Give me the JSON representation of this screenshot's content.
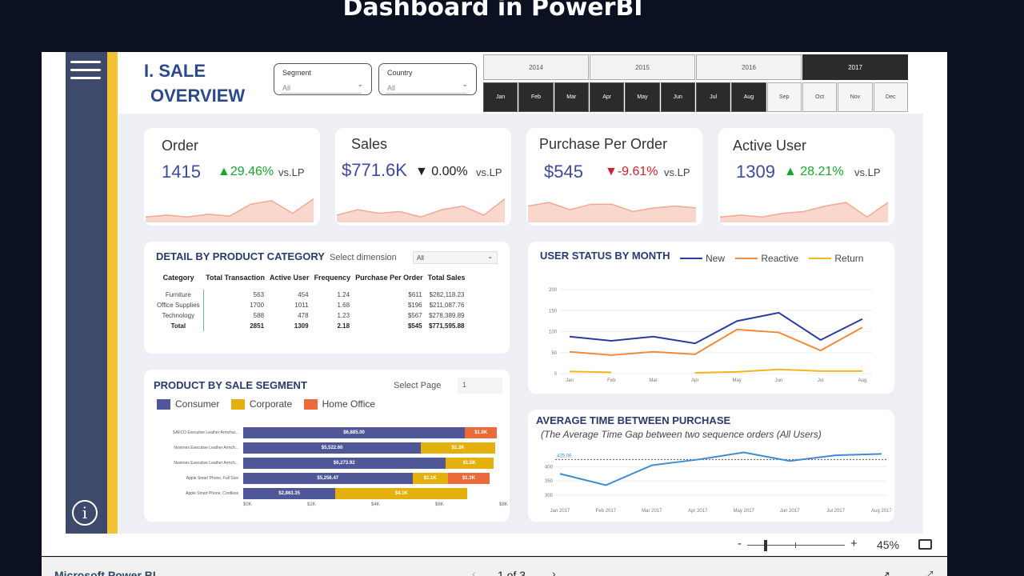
{
  "page_title": "Dashboard in PowerBI",
  "report": {
    "title_line1": "I. SALE",
    "title_line2": "OVERVIEW",
    "segment_slicer": {
      "label": "Segment",
      "value": "All"
    },
    "country_slicer": {
      "label": "Country",
      "value": "All"
    },
    "years": [
      "2014",
      "2015",
      "2016",
      "2017"
    ],
    "selected_year": "2017",
    "months": [
      "Jan",
      "Feb",
      "Mar",
      "Apr",
      "May",
      "Jun",
      "Jul",
      "Aug",
      "Sep",
      "Oct",
      "Nov",
      "Dec"
    ]
  },
  "kpis": [
    {
      "title": "Order",
      "value": "1415",
      "delta": "▲29.46%",
      "vs": "vs.LP",
      "direction": "up"
    },
    {
      "title": "Sales",
      "value": "$771.6K",
      "delta": "▼ 0.00%",
      "vs": "vs.LP",
      "direction": "down"
    },
    {
      "title": "Purchase Per Order",
      "value": "$545",
      "delta": "▼-9.61%",
      "vs": "vs.LP",
      "direction": "down"
    },
    {
      "title": "Active User",
      "value": "1309",
      "delta": "▲ 28.21%",
      "vs": "vs.LP",
      "direction": "up"
    }
  ],
  "category_table": {
    "title": "DETAIL BY PRODUCT CATEGORY",
    "select_label": "Select dimension",
    "select_value": "All",
    "headers": [
      "Category",
      "Total Transaction",
      "Active User",
      "Frequency",
      "Purchase Per Order",
      "Total Sales"
    ],
    "rows": [
      [
        "Furniture",
        "563",
        "454",
        "1.24",
        "$611",
        "$282,118.23"
      ],
      [
        "Office Supplies",
        "1700",
        "1011",
        "1.68",
        "$196",
        "$211,087.76"
      ],
      [
        "Technology",
        "588",
        "478",
        "1.23",
        "$567",
        "$278,389.89"
      ]
    ],
    "total": [
      "Total",
      "2851",
      "1309",
      "2.18",
      "$545",
      "$771,595.88"
    ]
  },
  "segment_chart": {
    "title": "PRODUCT BY SALE SEGMENT",
    "select_page_label": "Select Page",
    "select_page_value": "1",
    "legend": [
      "Consumer",
      "Corporate",
      "Home Office"
    ],
    "x_ticks": [
      "$0K",
      "$2K",
      "$4K",
      "$6K",
      "$8K"
    ]
  },
  "user_status": {
    "title": "USER STATUS BY MONTH",
    "legend": [
      "New",
      "Reactive",
      "Return"
    ]
  },
  "avg_time": {
    "title": "AVERAGE TIME BETWEEN PURCHASE",
    "subtitle": "(The Average Time Gap between two sequence orders (All Users)",
    "ref_label": "425.06"
  },
  "zoom": {
    "minus": "-",
    "plus": "+",
    "level": "45%"
  },
  "footer": {
    "app": "Microsoft Power BI",
    "pages": "1 of 3"
  },
  "colors": {
    "consumer": "#4f5796",
    "corporate": "#e3b00d",
    "home_office": "#ea6a3a",
    "new": "#2b3a9e",
    "reactive": "#f08a3c",
    "return": "#f2b71c",
    "avg": "#3f8ad0",
    "up": "#1aa32d",
    "down": "#d0222d"
  },
  "chart_data": [
    {
      "type": "bar",
      "title": "PRODUCT BY SALE SEGMENT",
      "orientation": "horizontal-stacked",
      "categories": [
        "SAFCO Executive Leather Armchai...",
        "Novimex Executive Leather Armch...",
        "Novimex Executive Leather Armch...",
        "Apple Smart Phone, Full Size",
        "Apple Smart Phone, Cordless"
      ],
      "series": [
        {
          "name": "Consumer",
          "values": [
            6885.0,
            5522.6,
            6273.92,
            5256.47,
            2863.35
          ],
          "labels": [
            "$6,885.00",
            "$5,522.60",
            "$6,273.92",
            "$5,256.47",
            "$2,863.35"
          ]
        },
        {
          "name": "Corporate",
          "values": [
            0,
            2300,
            1500,
            1100,
            4100
          ],
          "labels": [
            "",
            "$2.3K",
            "$1.5K",
            "$1.1K",
            "$4.1K"
          ]
        },
        {
          "name": "Home Office",
          "values": [
            1000,
            0,
            0,
            1300,
            0
          ],
          "labels": [
            "$1.0K",
            "",
            "",
            "$1.3K",
            ""
          ]
        }
      ],
      "xlim": [
        0,
        8000
      ]
    },
    {
      "type": "line",
      "title": "USER STATUS BY MONTH",
      "categories": [
        "Jan",
        "Feb",
        "Mar",
        "Apr",
        "May",
        "Jun",
        "Jul",
        "Aug"
      ],
      "y_ticks": [
        "0",
        "50",
        "100",
        "150",
        "200"
      ],
      "ylim": [
        0,
        200
      ],
      "series": [
        {
          "name": "New",
          "values": [
            88,
            78,
            88,
            72,
            125,
            145,
            80,
            130
          ]
        },
        {
          "name": "Reactive",
          "values": [
            52,
            44,
            52,
            46,
            105,
            98,
            55,
            110
          ]
        },
        {
          "name": "Return",
          "values": [
            5,
            3,
            null,
            2,
            4,
            10,
            6,
            6
          ]
        }
      ]
    },
    {
      "type": "line",
      "title": "AVERAGE TIME BETWEEN PURCHASE",
      "categories": [
        "Jan 2017",
        "Feb 2017",
        "Mar 2017",
        "Apr 2017",
        "May 2017",
        "Jun 2017",
        "Jul 2017",
        "Aug 2017"
      ],
      "y_ticks": [
        "300",
        "350",
        "400"
      ],
      "ylim": [
        280,
        460
      ],
      "reference_line": 425.06,
      "series": [
        {
          "name": "",
          "values": [
            375,
            335,
            405,
            425,
            450,
            420,
            440,
            445
          ]
        }
      ]
    },
    {
      "type": "area",
      "title": "Order",
      "values": [
        6,
        8,
        6,
        9,
        7,
        20,
        24,
        10,
        26
      ]
    },
    {
      "type": "area",
      "title": "Sales",
      "values": [
        8,
        14,
        10,
        12,
        6,
        14,
        18,
        8,
        26
      ]
    },
    {
      "type": "area",
      "title": "Purchase Per Order",
      "values": [
        18,
        22,
        14,
        20,
        20,
        12,
        16,
        18,
        16
      ]
    },
    {
      "type": "area",
      "title": "Active User",
      "values": [
        6,
        8,
        6,
        10,
        12,
        18,
        22,
        6,
        22
      ]
    }
  ]
}
